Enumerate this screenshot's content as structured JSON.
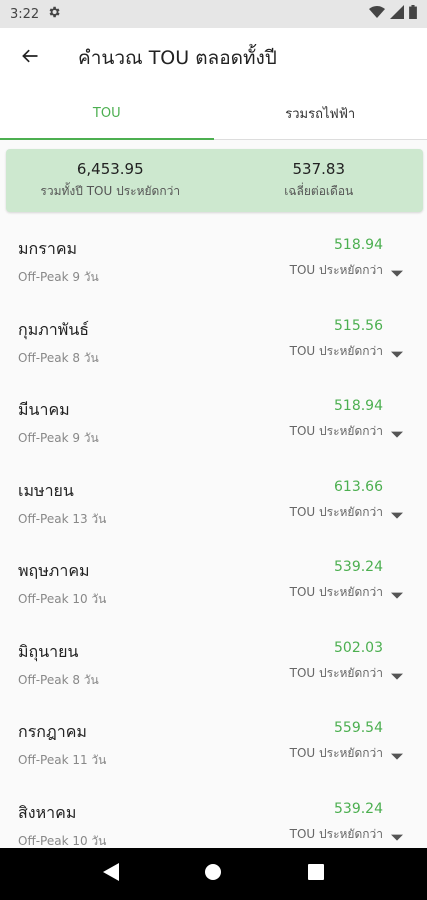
{
  "status_bar": {
    "time": "3:22"
  },
  "app_bar": {
    "title": "คำนวณ TOU ตลอดทั้งปี"
  },
  "tabs": [
    {
      "label": "TOU",
      "active": true
    },
    {
      "label": "รวมรถไฟฟ้า",
      "active": false
    }
  ],
  "summary": {
    "total_value": "6,453.95",
    "total_label": "รวมทั้งปี TOU ประหยัดกว่า",
    "avg_value": "537.83",
    "avg_label": "เฉลี่ยต่อเดือน"
  },
  "months": [
    {
      "name": "มกราคม",
      "offpeak": "Off-Peak 9 วัน",
      "amount": "518.94",
      "note": "TOU ประหยัดกว่า"
    },
    {
      "name": "กุมภาพันธ์",
      "offpeak": "Off-Peak 8 วัน",
      "amount": "515.56",
      "note": "TOU ประหยัดกว่า"
    },
    {
      "name": "มีนาคม",
      "offpeak": "Off-Peak 9 วัน",
      "amount": "518.94",
      "note": "TOU ประหยัดกว่า"
    },
    {
      "name": "เมษายน",
      "offpeak": "Off-Peak 13 วัน",
      "amount": "613.66",
      "note": "TOU ประหยัดกว่า"
    },
    {
      "name": "พฤษภาคม",
      "offpeak": "Off-Peak 10 วัน",
      "amount": "539.24",
      "note": "TOU ประหยัดกว่า"
    },
    {
      "name": "มิถุนายน",
      "offpeak": "Off-Peak 8 วัน",
      "amount": "502.03",
      "note": "TOU ประหยัดกว่า"
    },
    {
      "name": "กรกฎาคม",
      "offpeak": "Off-Peak 11 วัน",
      "amount": "559.54",
      "note": "TOU ประหยัดกว่า"
    },
    {
      "name": "สิงหาคม",
      "offpeak": "Off-Peak 10 วัน",
      "amount": "539.24",
      "note": "TOU ประหยัดกว่า"
    }
  ],
  "colors": {
    "accent": "#4caf50",
    "summary_bg": "#cde8cf"
  },
  "icons": [
    "settings-icon",
    "wifi-icon",
    "signal-icon",
    "battery-icon",
    "back-arrow-icon",
    "chevron-down-icon",
    "nav-back-icon",
    "nav-home-icon",
    "nav-recents-icon"
  ]
}
